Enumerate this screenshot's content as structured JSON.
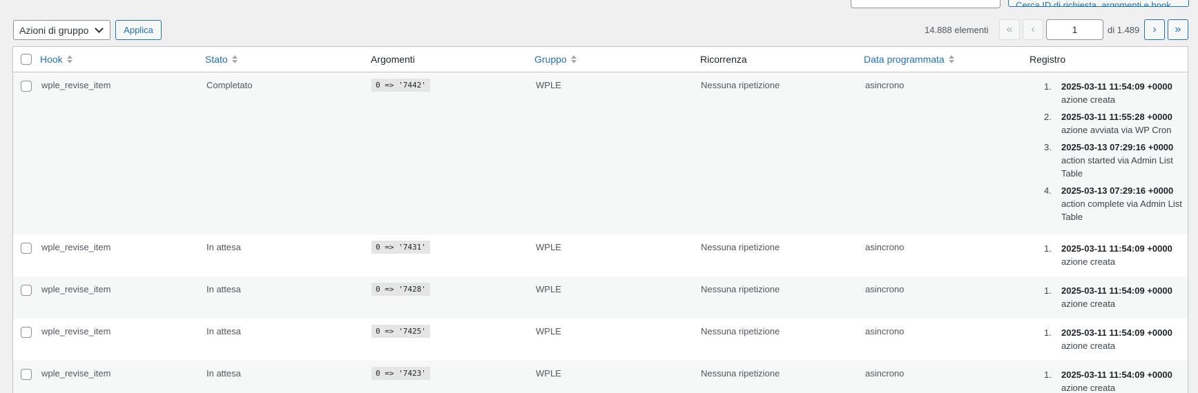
{
  "top": {
    "search_value": "",
    "search_button_label": "Cerca ID di richiesta, argomenti e hook"
  },
  "bulk": {
    "select_value": "Azioni di gruppo",
    "apply_label": "Applica"
  },
  "pagination": {
    "items_count": "14.888 elementi",
    "first": "«",
    "prev": "‹",
    "current_page": "1",
    "of_total": "di 1.489",
    "next": "›",
    "last": "»"
  },
  "table": {
    "columns": {
      "hook": "Hook",
      "status": "Stato",
      "args": "Argomenti",
      "group": "Gruppo",
      "recurrence": "Ricorrenza",
      "scheduled": "Data programmata",
      "log": "Registro"
    },
    "rows": [
      {
        "hook": "wple_revise_item",
        "status": "Completato",
        "args": "0 => '7442'",
        "group": "WPLE",
        "recurrence": "Nessuna ripetizione",
        "scheduled": "asincrono",
        "log": [
          {
            "num": "1.",
            "date": "2025-03-11 11:54:09 +0000",
            "text": "azione creata"
          },
          {
            "num": "2.",
            "date": "2025-03-11 11:55:28 +0000",
            "text": "azione avviata via WP Cron"
          },
          {
            "num": "3.",
            "date": "2025-03-13 07:29:16 +0000",
            "text": "action started via Admin List Table"
          },
          {
            "num": "4.",
            "date": "2025-03-13 07:29:16 +0000",
            "text": "action complete via Admin List Table"
          }
        ]
      },
      {
        "hook": "wple_revise_item",
        "status": "In attesa",
        "args": "0 => '7431'",
        "group": "WPLE",
        "recurrence": "Nessuna ripetizione",
        "scheduled": "asincrono",
        "log": [
          {
            "num": "1.",
            "date": "2025-03-11 11:54:09 +0000",
            "text": "azione creata"
          }
        ]
      },
      {
        "hook": "wple_revise_item",
        "status": "In attesa",
        "args": "0 => '7428'",
        "group": "WPLE",
        "recurrence": "Nessuna ripetizione",
        "scheduled": "asincrono",
        "log": [
          {
            "num": "1.",
            "date": "2025-03-11 11:54:09 +0000",
            "text": "azione creata"
          }
        ]
      },
      {
        "hook": "wple_revise_item",
        "status": "In attesa",
        "args": "0 => '7425'",
        "group": "WPLE",
        "recurrence": "Nessuna ripetizione",
        "scheduled": "asincrono",
        "log": [
          {
            "num": "1.",
            "date": "2025-03-11 11:54:09 +0000",
            "text": "azione creata"
          }
        ]
      },
      {
        "hook": "wple_revise_item",
        "status": "In attesa",
        "args": "0 => '7423'",
        "group": "WPLE",
        "recurrence": "Nessuna ripetizione",
        "scheduled": "asincrono",
        "log": [
          {
            "num": "1.",
            "date": "2025-03-11 11:54:09 +0000",
            "text": "azione creata"
          }
        ]
      }
    ]
  }
}
